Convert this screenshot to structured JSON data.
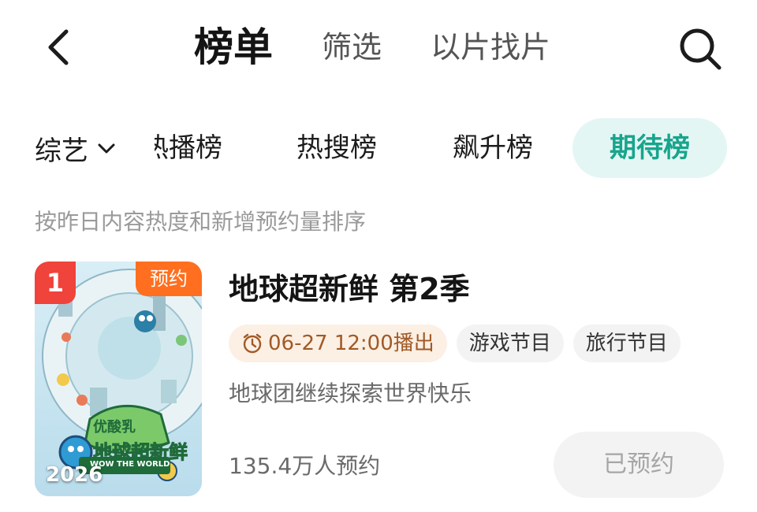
{
  "header": {
    "tabs": [
      {
        "label": "榜单",
        "active": true
      },
      {
        "label": "筛选",
        "active": false
      },
      {
        "label": "以片找片",
        "active": false
      }
    ],
    "back_icon": "chevron-left-icon",
    "search_icon": "search-icon"
  },
  "category": {
    "selected": "综艺",
    "icon": "chevron-down-icon"
  },
  "rank_tabs": [
    {
      "label": "热播榜",
      "active": false
    },
    {
      "label": "热搜榜",
      "active": false
    },
    {
      "label": "飙升榜",
      "active": false
    },
    {
      "label": "期待榜",
      "active": true
    }
  ],
  "sort_note": "按昨日内容热度和新增预约量排序",
  "items": [
    {
      "rank": "1",
      "tag": "预约",
      "poster_year": "2026",
      "title": "地球超新鲜 第2季",
      "air_time": "06-27 12:00播出",
      "genres": [
        "游戏节目",
        "旅行节目"
      ],
      "description": "地球团继续探索世界快乐",
      "reservations": "135.4万人预约",
      "button_label": "已预约",
      "poster_logo_top": "优酸乳",
      "poster_logo_main": "地球超新鲜",
      "poster_logo_sub": "WOW THE WORLD"
    }
  ],
  "colors": {
    "accent": "#17a58c",
    "accent_bg": "#e4f6f4",
    "rank_badge": "#f0433b",
    "reserve_tag": "#ff6f1f",
    "time_chip_bg": "#fcefe4"
  }
}
